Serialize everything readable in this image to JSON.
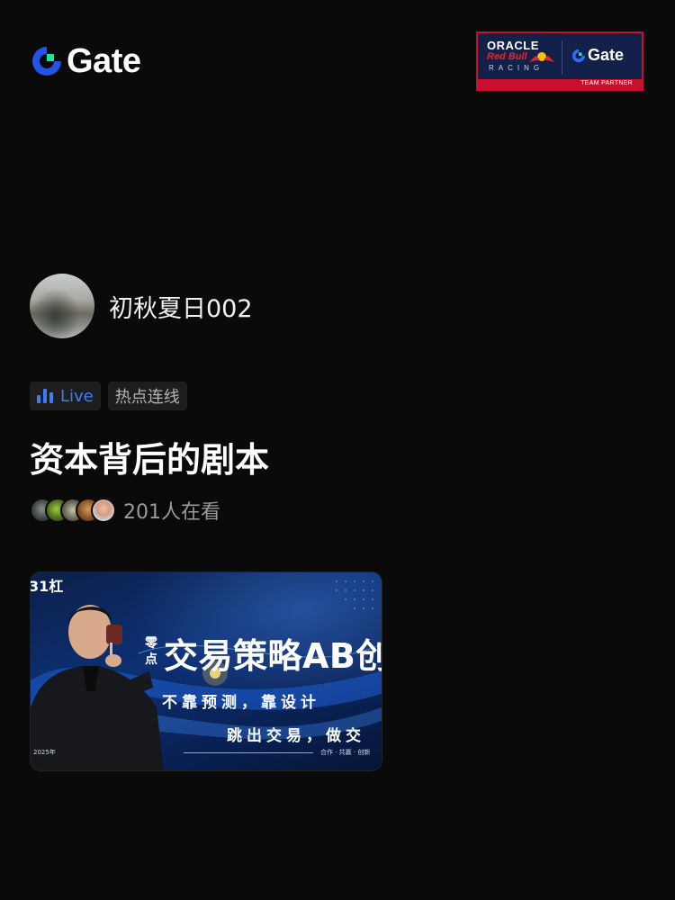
{
  "header": {
    "logo_text": "Gate",
    "partner_badge": {
      "oracle": "ORACLE",
      "redbull": "Red Bull",
      "racing": "RACING",
      "gate": "Gate",
      "team_partner": "TEAM PARTNER"
    }
  },
  "host": {
    "name": "初秋夏日002"
  },
  "tags": {
    "live_label": "Live",
    "topic_label": "热点连线"
  },
  "stream": {
    "title": "资本背后的剧本",
    "viewer_count_text": "201人在看"
  },
  "cover": {
    "corner_text": "31杠",
    "small_text": "零点",
    "headline": "交易策略AB创",
    "subline_1": "不靠预测，靠设计",
    "subline_2": "跳出交易，做交",
    "year": "2025年",
    "tagline": "合作 · 共赢 · 创新"
  },
  "colors": {
    "background": "#0a0a0a",
    "accent_blue": "#3d7cf2",
    "tag_bg": "#1e1e1e",
    "muted_text": "#9a9a9a",
    "partner_red": "#c8102e",
    "partner_navy": "#12204a"
  }
}
